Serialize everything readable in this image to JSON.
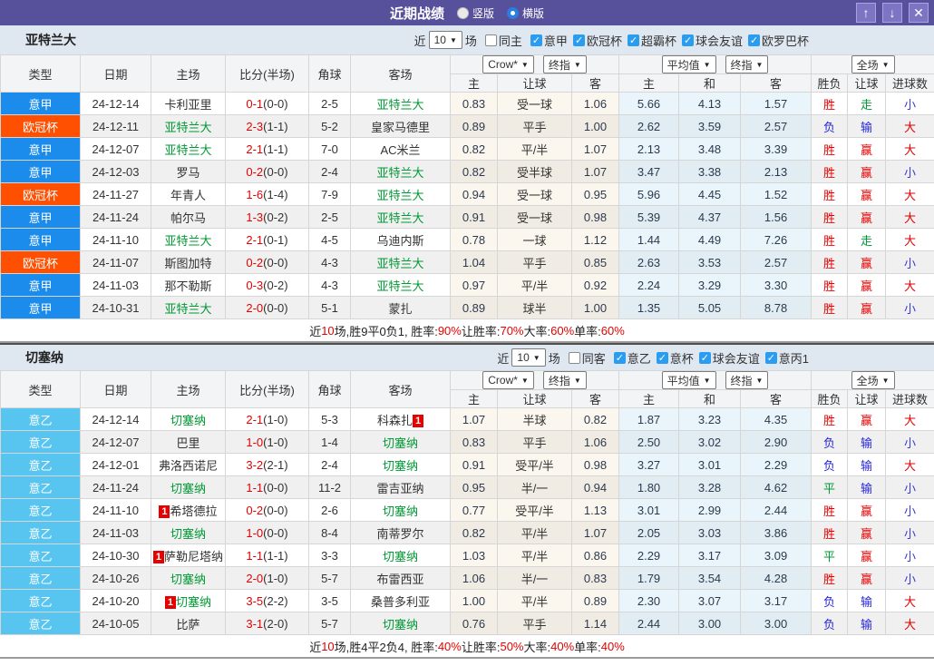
{
  "titlebar": {
    "title": "近期战绩",
    "radio_vertical_label": "竖版",
    "radio_horizontal_label": "横版",
    "up_icon": "↑",
    "down_icon": "↓",
    "close_icon": "✕"
  },
  "columns": {
    "type": "类型",
    "date": "日期",
    "home": "主场",
    "score": "比分(半场)",
    "corner": "角球",
    "away": "客场",
    "sub": [
      "主",
      "让球",
      "客",
      "主",
      "和",
      "客",
      "胜负",
      "让球",
      "进球数"
    ]
  },
  "selects": {
    "count": "10",
    "crow": "Crow*",
    "final1": "终指",
    "avg": "平均值",
    "final2": "终指",
    "full": "全场"
  },
  "league_colors": {
    "意甲": "#1b8ceb",
    "欧冠杯": "#ff4f00",
    "意乙": "#58c5f0"
  },
  "result_colors": {
    "胜": "#e60000",
    "负": "#2626d8",
    "平": "#009933",
    "赢": "#e60000",
    "输": "#2626d8",
    "走": "#009933",
    "大": "#e60000",
    "小": "#3a3ad0"
  },
  "sections": [
    {
      "team": "亚特兰大",
      "filter": {
        "near": "近",
        "games": "场",
        "same_label": "同主",
        "leagues": [
          "意甲",
          "欧冠杯",
          "超霸杯",
          "球会友谊",
          "欧罗巴杯"
        ]
      },
      "rows": [
        {
          "league": "意甲",
          "date": "24-12-14",
          "home": "卡利亚里",
          "home_green": false,
          "home_card": "",
          "score": "0-1",
          "half": "(0-0)",
          "corner": "2-5",
          "away": "亚特兰大",
          "away_green": true,
          "away_card": "",
          "odds": [
            "0.83",
            "受一球",
            "1.06",
            "5.66",
            "4.13",
            "1.57"
          ],
          "res": [
            "胜",
            "走",
            "小"
          ]
        },
        {
          "league": "欧冠杯",
          "date": "24-12-11",
          "home": "亚特兰大",
          "home_green": true,
          "home_card": "",
          "score": "2-3",
          "half": "(1-1)",
          "corner": "5-2",
          "away": "皇家马德里",
          "away_green": false,
          "away_card": "",
          "odds": [
            "0.89",
            "平手",
            "1.00",
            "2.62",
            "3.59",
            "2.57"
          ],
          "res": [
            "负",
            "输",
            "大"
          ]
        },
        {
          "league": "意甲",
          "date": "24-12-07",
          "home": "亚特兰大",
          "home_green": true,
          "home_card": "",
          "score": "2-1",
          "half": "(1-1)",
          "corner": "7-0",
          "away": "AC米兰",
          "away_green": false,
          "away_card": "",
          "odds": [
            "0.82",
            "平/半",
            "1.07",
            "2.13",
            "3.48",
            "3.39"
          ],
          "res": [
            "胜",
            "赢",
            "大"
          ]
        },
        {
          "league": "意甲",
          "date": "24-12-03",
          "home": "罗马",
          "home_green": false,
          "home_card": "",
          "score": "0-2",
          "half": "(0-0)",
          "corner": "2-4",
          "away": "亚特兰大",
          "away_green": true,
          "away_card": "",
          "odds": [
            "0.82",
            "受半球",
            "1.07",
            "3.47",
            "3.38",
            "2.13"
          ],
          "res": [
            "胜",
            "赢",
            "小"
          ]
        },
        {
          "league": "欧冠杯",
          "date": "24-11-27",
          "home": "年青人",
          "home_green": false,
          "home_card": "",
          "score": "1-6",
          "half": "(1-4)",
          "corner": "7-9",
          "away": "亚特兰大",
          "away_green": true,
          "away_card": "",
          "odds": [
            "0.94",
            "受一球",
            "0.95",
            "5.96",
            "4.45",
            "1.52"
          ],
          "res": [
            "胜",
            "赢",
            "大"
          ]
        },
        {
          "league": "意甲",
          "date": "24-11-24",
          "home": "帕尔马",
          "home_green": false,
          "home_card": "",
          "score": "1-3",
          "half": "(0-2)",
          "corner": "2-5",
          "away": "亚特兰大",
          "away_green": true,
          "away_card": "",
          "odds": [
            "0.91",
            "受一球",
            "0.98",
            "5.39",
            "4.37",
            "1.56"
          ],
          "res": [
            "胜",
            "赢",
            "大"
          ]
        },
        {
          "league": "意甲",
          "date": "24-11-10",
          "home": "亚特兰大",
          "home_green": true,
          "home_card": "",
          "score": "2-1",
          "half": "(0-1)",
          "corner": "4-5",
          "away": "乌迪内斯",
          "away_green": false,
          "away_card": "",
          "odds": [
            "0.78",
            "一球",
            "1.12",
            "1.44",
            "4.49",
            "7.26"
          ],
          "res": [
            "胜",
            "走",
            "大"
          ]
        },
        {
          "league": "欧冠杯",
          "date": "24-11-07",
          "home": "斯图加特",
          "home_green": false,
          "home_card": "",
          "score": "0-2",
          "half": "(0-0)",
          "corner": "4-3",
          "away": "亚特兰大",
          "away_green": true,
          "away_card": "",
          "odds": [
            "1.04",
            "平手",
            "0.85",
            "2.63",
            "3.53",
            "2.57"
          ],
          "res": [
            "胜",
            "赢",
            "小"
          ]
        },
        {
          "league": "意甲",
          "date": "24-11-03",
          "home": "那不勒斯",
          "home_green": false,
          "home_card": "",
          "score": "0-3",
          "half": "(0-2)",
          "corner": "4-3",
          "away": "亚特兰大",
          "away_green": true,
          "away_card": "",
          "odds": [
            "0.97",
            "平/半",
            "0.92",
            "2.24",
            "3.29",
            "3.30"
          ],
          "res": [
            "胜",
            "赢",
            "大"
          ]
        },
        {
          "league": "意甲",
          "date": "24-10-31",
          "home": "亚特兰大",
          "home_green": true,
          "home_card": "",
          "score": "2-0",
          "half": "(0-0)",
          "corner": "5-1",
          "away": "蒙扎",
          "away_green": false,
          "away_card": "",
          "odds": [
            "0.89",
            "球半",
            "1.00",
            "1.35",
            "5.05",
            "8.78"
          ],
          "res": [
            "胜",
            "赢",
            "小"
          ]
        }
      ],
      "summary": [
        [
          "近",
          "k"
        ],
        [
          "10",
          "r"
        ],
        [
          "场,胜9平0负1, 胜率:",
          "k"
        ],
        [
          "90%",
          "r"
        ],
        [
          " 让胜率:",
          "k"
        ],
        [
          "70%",
          "r"
        ],
        [
          " 大率:",
          "k"
        ],
        [
          "60%",
          "r"
        ],
        [
          " 单率:",
          "k"
        ],
        [
          "60%",
          "r"
        ]
      ]
    },
    {
      "team": "切塞纳",
      "filter": {
        "near": "近",
        "games": "场",
        "same_label": "同客",
        "leagues": [
          "意乙",
          "意杯",
          "球会友谊",
          "意丙1"
        ]
      },
      "rows": [
        {
          "league": "意乙",
          "date": "24-12-14",
          "home": "切塞纳",
          "home_green": true,
          "home_card": "",
          "score": "2-1",
          "half": "(1-0)",
          "corner": "5-3",
          "away": "科森扎",
          "away_green": false,
          "away_card": "1",
          "odds": [
            "1.07",
            "半球",
            "0.82",
            "1.87",
            "3.23",
            "4.35"
          ],
          "res": [
            "胜",
            "赢",
            "大"
          ]
        },
        {
          "league": "意乙",
          "date": "24-12-07",
          "home": "巴里",
          "home_green": false,
          "home_card": "",
          "score": "1-0",
          "half": "(1-0)",
          "corner": "1-4",
          "away": "切塞纳",
          "away_green": true,
          "away_card": "",
          "odds": [
            "0.83",
            "平手",
            "1.06",
            "2.50",
            "3.02",
            "2.90"
          ],
          "res": [
            "负",
            "输",
            "小"
          ]
        },
        {
          "league": "意乙",
          "date": "24-12-01",
          "home": "弗洛西诺尼",
          "home_green": false,
          "home_card": "",
          "score": "3-2",
          "half": "(2-1)",
          "corner": "2-4",
          "away": "切塞纳",
          "away_green": true,
          "away_card": "",
          "odds": [
            "0.91",
            "受平/半",
            "0.98",
            "3.27",
            "3.01",
            "2.29"
          ],
          "res": [
            "负",
            "输",
            "大"
          ]
        },
        {
          "league": "意乙",
          "date": "24-11-24",
          "home": "切塞纳",
          "home_green": true,
          "home_card": "",
          "score": "1-1",
          "half": "(0-0)",
          "corner": "11-2",
          "away": "雷吉亚纳",
          "away_green": false,
          "away_card": "",
          "odds": [
            "0.95",
            "半/一",
            "0.94",
            "1.80",
            "3.28",
            "4.62"
          ],
          "res": [
            "平",
            "输",
            "小"
          ]
        },
        {
          "league": "意乙",
          "date": "24-11-10",
          "home": "希塔德拉",
          "home_green": false,
          "home_card": "1",
          "score": "0-2",
          "half": "(0-0)",
          "corner": "2-6",
          "away": "切塞纳",
          "away_green": true,
          "away_card": "",
          "odds": [
            "0.77",
            "受平/半",
            "1.13",
            "3.01",
            "2.99",
            "2.44"
          ],
          "res": [
            "胜",
            "赢",
            "小"
          ]
        },
        {
          "league": "意乙",
          "date": "24-11-03",
          "home": "切塞纳",
          "home_green": true,
          "home_card": "",
          "score": "1-0",
          "half": "(0-0)",
          "corner": "8-4",
          "away": "南蒂罗尔",
          "away_green": false,
          "away_card": "",
          "odds": [
            "0.82",
            "平/半",
            "1.07",
            "2.05",
            "3.03",
            "3.86"
          ],
          "res": [
            "胜",
            "赢",
            "小"
          ]
        },
        {
          "league": "意乙",
          "date": "24-10-30",
          "home": "萨勒尼塔纳",
          "home_green": false,
          "home_card": "1",
          "score": "1-1",
          "half": "(1-1)",
          "corner": "3-3",
          "away": "切塞纳",
          "away_green": true,
          "away_card": "",
          "odds": [
            "1.03",
            "平/半",
            "0.86",
            "2.29",
            "3.17",
            "3.09"
          ],
          "res": [
            "平",
            "赢",
            "小"
          ]
        },
        {
          "league": "意乙",
          "date": "24-10-26",
          "home": "切塞纳",
          "home_green": true,
          "home_card": "",
          "score": "2-0",
          "half": "(1-0)",
          "corner": "5-7",
          "away": "布雷西亚",
          "away_green": false,
          "away_card": "",
          "odds": [
            "1.06",
            "半/一",
            "0.83",
            "1.79",
            "3.54",
            "4.28"
          ],
          "res": [
            "胜",
            "赢",
            "小"
          ]
        },
        {
          "league": "意乙",
          "date": "24-10-20",
          "home": "切塞纳",
          "home_green": true,
          "home_card": "1",
          "score": "3-5",
          "half": "(2-2)",
          "corner": "3-5",
          "away": "桑普多利亚",
          "away_green": false,
          "away_card": "",
          "odds": [
            "1.00",
            "平/半",
            "0.89",
            "2.30",
            "3.07",
            "3.17"
          ],
          "res": [
            "负",
            "输",
            "大"
          ]
        },
        {
          "league": "意乙",
          "date": "24-10-05",
          "home": "比萨",
          "home_green": false,
          "home_card": "",
          "score": "3-1",
          "half": "(2-0)",
          "corner": "5-7",
          "away": "切塞纳",
          "away_green": true,
          "away_card": "",
          "odds": [
            "0.76",
            "平手",
            "1.14",
            "2.44",
            "3.00",
            "3.00"
          ],
          "res": [
            "负",
            "输",
            "大"
          ]
        }
      ],
      "summary": [
        [
          "近",
          "k"
        ],
        [
          "10",
          "r"
        ],
        [
          "场,胜4平2负4, 胜率:",
          "k"
        ],
        [
          "40%",
          "r"
        ],
        [
          " 让胜率:",
          "k"
        ],
        [
          "50%",
          "r"
        ],
        [
          " 大率:",
          "k"
        ],
        [
          "40%",
          "r"
        ],
        [
          " 单率:",
          "k"
        ],
        [
          "40%",
          "r"
        ]
      ]
    }
  ]
}
